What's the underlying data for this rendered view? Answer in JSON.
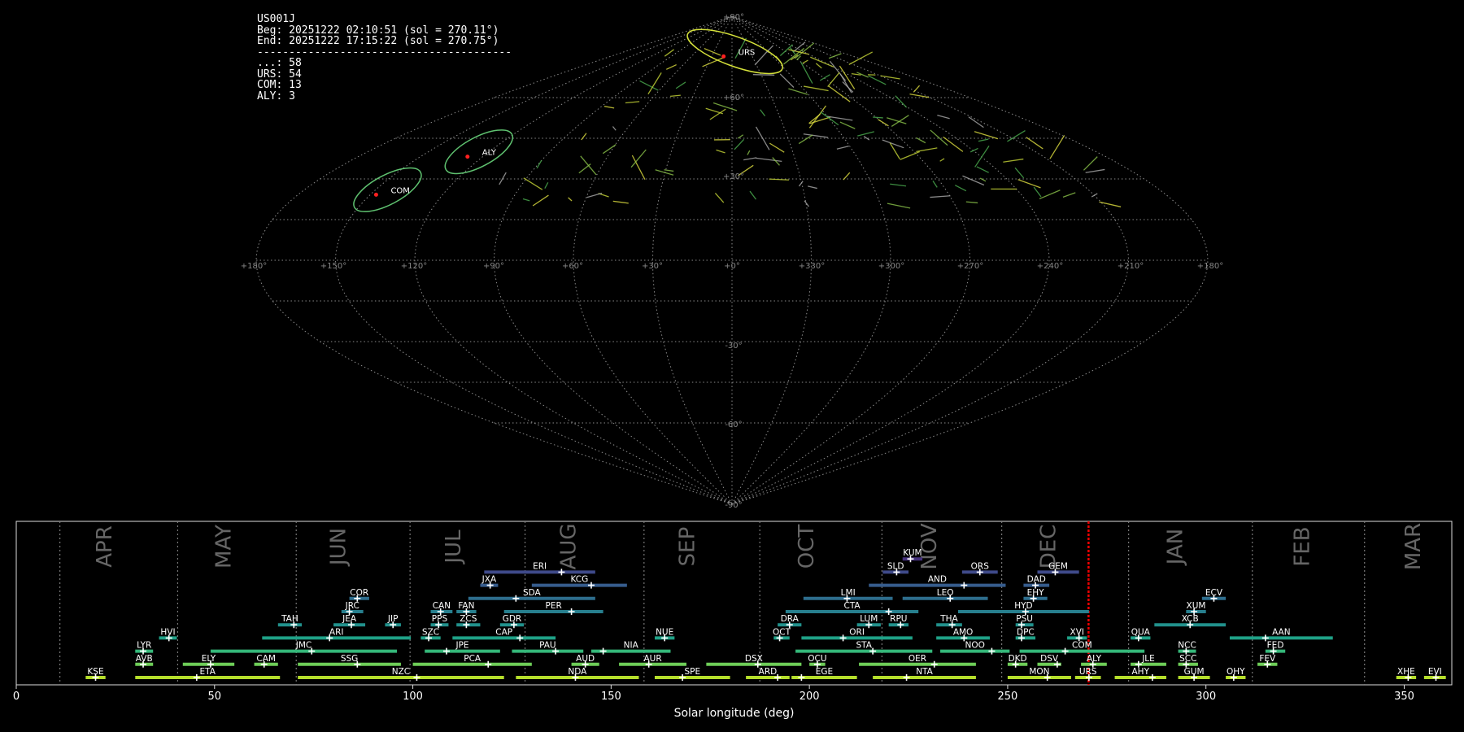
{
  "info_panel": {
    "station": "US001J",
    "begin": "Beg: 20251222 02:10:51 (sol = 270.11°)",
    "end": "End: 20251222 17:15:22 (sol = 270.75°)",
    "separator": "----------------------------------------",
    "counts": [
      "...: 58",
      "URS: 54",
      "COM: 13",
      "ALY: 3"
    ]
  },
  "sky_map": {
    "projection": "sinusoidal",
    "lon_labels": [
      "+180°",
      "+150°",
      "+120°",
      "+90°",
      "+60°",
      "+30°",
      "+0°",
      "+330°",
      "+300°",
      "+270°",
      "+240°",
      "+210°",
      "+180°"
    ],
    "lat_labels": [
      "+90°",
      "+60°",
      "+30°",
      "-30°",
      "-60°",
      "-90°"
    ],
    "radiants": [
      {
        "name": "URS",
        "lon": 355,
        "lat": 77,
        "color": "#d6e23a"
      },
      {
        "name": "ALY",
        "lon": 125,
        "lat": 40,
        "color": "#5fc270"
      },
      {
        "name": "COM",
        "lon": 145,
        "lat": 26,
        "color": "#5fc270"
      }
    ],
    "colors": {
      "grid": "#8a8a8a",
      "radiant_marker": "#ff2020"
    }
  },
  "chart_data": {
    "type": "timeline",
    "xlabel": "Solar longitude (deg)",
    "xlim": [
      0,
      362
    ],
    "xticks": [
      0,
      50,
      100,
      150,
      200,
      250,
      300,
      350
    ],
    "current_sol": 270.4,
    "months": [
      {
        "name": "APR",
        "start": 11,
        "mid": 24
      },
      {
        "name": "MAY",
        "start": 40.7,
        "mid": 54
      },
      {
        "name": "JUN",
        "start": 70.6,
        "mid": 83
      },
      {
        "name": "JUL",
        "start": 99.3,
        "mid": 112
      },
      {
        "name": "AUG",
        "start": 128.3,
        "mid": 141
      },
      {
        "name": "SEP",
        "start": 158.3,
        "mid": 171
      },
      {
        "name": "OCT",
        "start": 187.5,
        "mid": 201
      },
      {
        "name": "NOV",
        "start": 218.3,
        "mid": 232
      },
      {
        "name": "DEC",
        "start": 248.5,
        "mid": 262
      },
      {
        "name": "JAN",
        "start": 280.5,
        "mid": 294
      },
      {
        "name": "FEB",
        "start": 311.7,
        "mid": 326
      },
      {
        "name": "MAR",
        "start": 340,
        "mid": 354
      }
    ],
    "showers": [
      {
        "code": "KUM",
        "row": 10,
        "start": 223.5,
        "end": 228.5,
        "peak": 225.5,
        "color": "#46327e"
      },
      {
        "code": "ERI",
        "row": 9,
        "start": 118,
        "end": 146,
        "peak": 137.5,
        "color": "#3f4a8a"
      },
      {
        "code": "SLD",
        "row": 9,
        "start": 218.5,
        "end": 225,
        "peak": 222,
        "color": "#3f4a8a"
      },
      {
        "code": "ORS",
        "row": 9,
        "start": 238.5,
        "end": 247.5,
        "peak": 243,
        "color": "#3f4a8a"
      },
      {
        "code": "GEM",
        "row": 9,
        "start": 257.5,
        "end": 268,
        "peak": 262,
        "color": "#3f4a8a"
      },
      {
        "code": "JXA",
        "row": 8,
        "start": 117,
        "end": 121.5,
        "peak": 119.5,
        "color": "#365c8d"
      },
      {
        "code": "KCG",
        "row": 8,
        "start": 130,
        "end": 154,
        "peak": 145,
        "color": "#365c8d"
      },
      {
        "code": "AND",
        "row": 8,
        "start": 215,
        "end": 249.5,
        "peak": 239,
        "color": "#365c8d"
      },
      {
        "code": "DAD",
        "row": 8,
        "start": 254,
        "end": 260.5,
        "peak": 257,
        "color": "#365c8d"
      },
      {
        "code": "COR",
        "row": 7,
        "start": 84,
        "end": 89,
        "peak": 86,
        "color": "#2e6e8e"
      },
      {
        "code": "SDA",
        "row": 7,
        "start": 114,
        "end": 146,
        "peak": 126,
        "color": "#2e6e8e"
      },
      {
        "code": "LMI",
        "row": 7,
        "start": 198.5,
        "end": 221,
        "peak": 209.5,
        "color": "#2e6e8e"
      },
      {
        "code": "LEO",
        "row": 7,
        "start": 223.5,
        "end": 245,
        "peak": 235.5,
        "color": "#2e6e8e"
      },
      {
        "code": "EHY",
        "row": 7,
        "start": 254,
        "end": 260,
        "peak": 256.5,
        "color": "#2e6e8e"
      },
      {
        "code": "ECV",
        "row": 7,
        "start": 299,
        "end": 305,
        "peak": 302,
        "color": "#2e6e8e"
      },
      {
        "code": "JRC",
        "row": 6,
        "start": 82,
        "end": 87.5,
        "peak": 84,
        "color": "#277f8e"
      },
      {
        "code": "CAN",
        "row": 6,
        "start": 104.5,
        "end": 110,
        "peak": 107,
        "color": "#277f8e"
      },
      {
        "code": "FAN",
        "row": 6,
        "start": 111,
        "end": 116,
        "peak": 113.5,
        "color": "#277f8e"
      },
      {
        "code": "PER",
        "row": 6,
        "start": 123,
        "end": 148,
        "peak": 140,
        "color": "#277f8e"
      },
      {
        "code": "CTA",
        "row": 6,
        "start": 194,
        "end": 227.5,
        "peak": 220,
        "color": "#277f8e"
      },
      {
        "code": "HYD",
        "row": 6,
        "start": 237.5,
        "end": 270.5,
        "peak": 254.5,
        "color": "#277f8e"
      },
      {
        "code": "XUM",
        "row": 6,
        "start": 295,
        "end": 300,
        "peak": 297,
        "color": "#277f8e"
      },
      {
        "code": "TAH",
        "row": 5,
        "start": 66,
        "end": 72,
        "peak": 70,
        "color": "#21918c"
      },
      {
        "code": "JEA",
        "row": 5,
        "start": 80,
        "end": 88,
        "peak": 84.5,
        "color": "#21918c"
      },
      {
        "code": "JIP",
        "row": 5,
        "start": 93,
        "end": 97,
        "peak": 95,
        "color": "#21918c"
      },
      {
        "code": "PPS",
        "row": 5,
        "start": 104.5,
        "end": 109,
        "peak": 106.5,
        "color": "#21918c"
      },
      {
        "code": "ZCS",
        "row": 5,
        "start": 111,
        "end": 117,
        "peak": 113.5,
        "color": "#21918c"
      },
      {
        "code": "GDR",
        "row": 5,
        "start": 122,
        "end": 128,
        "peak": 125.5,
        "color": "#21918c"
      },
      {
        "code": "DRA",
        "row": 5,
        "start": 192,
        "end": 198,
        "peak": 195,
        "color": "#21918c"
      },
      {
        "code": "LUM",
        "row": 5,
        "start": 212,
        "end": 218,
        "peak": 215,
        "color": "#21918c"
      },
      {
        "code": "RPU",
        "row": 5,
        "start": 220,
        "end": 225,
        "peak": 223,
        "color": "#21918c"
      },
      {
        "code": "THA",
        "row": 5,
        "start": 232,
        "end": 238.5,
        "peak": 236,
        "color": "#21918c"
      },
      {
        "code": "PSU",
        "row": 5,
        "start": 252,
        "end": 256.5,
        "peak": 253.5,
        "color": "#21918c"
      },
      {
        "code": "XCB",
        "row": 5,
        "start": 287,
        "end": 305,
        "peak": 296,
        "color": "#21918c"
      },
      {
        "code": "HVI",
        "row": 4,
        "start": 36,
        "end": 40.5,
        "peak": 38.5,
        "color": "#1fa187"
      },
      {
        "code": "ARI",
        "row": 4,
        "start": 62,
        "end": 99.5,
        "peak": 79,
        "color": "#1fa187"
      },
      {
        "code": "SZC",
        "row": 4,
        "start": 102,
        "end": 107,
        "peak": 104,
        "color": "#1fa187"
      },
      {
        "code": "CAP",
        "row": 4,
        "start": 110,
        "end": 136,
        "peak": 127,
        "color": "#1fa187"
      },
      {
        "code": "NUE",
        "row": 4,
        "start": 161,
        "end": 166,
        "peak": 163.5,
        "color": "#1fa187"
      },
      {
        "code": "OCT",
        "row": 4,
        "start": 191,
        "end": 195,
        "peak": 192.5,
        "color": "#1fa187"
      },
      {
        "code": "ORI",
        "row": 4,
        "start": 198,
        "end": 226,
        "peak": 208.5,
        "color": "#1fa187"
      },
      {
        "code": "AMO",
        "row": 4,
        "start": 232,
        "end": 245.5,
        "peak": 239,
        "color": "#1fa187"
      },
      {
        "code": "DPC",
        "row": 4,
        "start": 252,
        "end": 257,
        "peak": 253.5,
        "color": "#1fa187"
      },
      {
        "code": "XVI",
        "row": 4,
        "start": 265,
        "end": 270,
        "peak": 268,
        "color": "#1fa187"
      },
      {
        "code": "QUA",
        "row": 4,
        "start": 281,
        "end": 286,
        "peak": 283,
        "color": "#1fa187"
      },
      {
        "code": "AAN",
        "row": 4,
        "start": 306,
        "end": 332,
        "peak": 315,
        "color": "#1fa187"
      },
      {
        "code": "LYR",
        "row": 3,
        "start": 30,
        "end": 34.5,
        "peak": 32,
        "color": "#35b779"
      },
      {
        "code": "JMC",
        "row": 3,
        "start": 49,
        "end": 96,
        "peak": 74.5,
        "color": "#35b779"
      },
      {
        "code": "JPE",
        "row": 3,
        "start": 103,
        "end": 122,
        "peak": 108.5,
        "color": "#35b779"
      },
      {
        "code": "PAU",
        "row": 3,
        "start": 125,
        "end": 143,
        "peak": 136,
        "color": "#35b779"
      },
      {
        "code": "NIA",
        "row": 3,
        "start": 145,
        "end": 165,
        "peak": 148,
        "color": "#35b779"
      },
      {
        "code": "STA",
        "row": 3,
        "start": 196.5,
        "end": 231,
        "peak": 216,
        "color": "#35b779"
      },
      {
        "code": "NOO",
        "row": 3,
        "start": 233,
        "end": 250.5,
        "peak": 246,
        "color": "#35b779"
      },
      {
        "code": "COM",
        "row": 3,
        "start": 253,
        "end": 284.5,
        "peak": 264.5,
        "color": "#35b779"
      },
      {
        "code": "NCC",
        "row": 3,
        "start": 293,
        "end": 297.5,
        "peak": 295,
        "color": "#35b779"
      },
      {
        "code": "FED",
        "row": 3,
        "start": 315,
        "end": 320,
        "peak": 317,
        "color": "#35b779"
      },
      {
        "code": "AVB",
        "row": 2,
        "start": 30,
        "end": 34.5,
        "peak": 32,
        "color": "#6ece58"
      },
      {
        "code": "ELY",
        "row": 2,
        "start": 42,
        "end": 55,
        "peak": 49,
        "color": "#6ece58"
      },
      {
        "code": "CAM",
        "row": 2,
        "start": 60,
        "end": 66,
        "peak": 62.5,
        "color": "#6ece58"
      },
      {
        "code": "SSG",
        "row": 2,
        "start": 71,
        "end": 97,
        "peak": 86,
        "color": "#6ece58"
      },
      {
        "code": "PCA",
        "row": 2,
        "start": 100,
        "end": 130,
        "peak": 119,
        "color": "#6ece58"
      },
      {
        "code": "AUD",
        "row": 2,
        "start": 140,
        "end": 147,
        "peak": 143.5,
        "color": "#6ece58"
      },
      {
        "code": "AUR",
        "row": 2,
        "start": 152,
        "end": 169,
        "peak": 159.5,
        "color": "#6ece58"
      },
      {
        "code": "DSX",
        "row": 2,
        "start": 174,
        "end": 198,
        "peak": 187,
        "color": "#6ece58"
      },
      {
        "code": "OCU",
        "row": 2,
        "start": 200,
        "end": 204,
        "peak": 202,
        "color": "#6ece58"
      },
      {
        "code": "OER",
        "row": 2,
        "start": 212.5,
        "end": 242,
        "peak": 231.5,
        "color": "#6ece58"
      },
      {
        "code": "DKD",
        "row": 2,
        "start": 250,
        "end": 255,
        "peak": 252,
        "color": "#6ece58"
      },
      {
        "code": "DSV",
        "row": 2,
        "start": 257.5,
        "end": 263.5,
        "peak": 262.5,
        "color": "#6ece58"
      },
      {
        "code": "ALY",
        "row": 2,
        "start": 268.5,
        "end": 275,
        "peak": 271.5,
        "color": "#6ece58"
      },
      {
        "code": "JLE",
        "row": 2,
        "start": 281,
        "end": 290,
        "peak": 283,
        "color": "#6ece58"
      },
      {
        "code": "SCC",
        "row": 2,
        "start": 293,
        "end": 298,
        "peak": 295,
        "color": "#6ece58"
      },
      {
        "code": "FEV",
        "row": 2,
        "start": 313,
        "end": 318,
        "peak": 315.5,
        "color": "#6ece58"
      },
      {
        "code": "KSE",
        "row": 1,
        "start": 17.5,
        "end": 22.5,
        "peak": 20,
        "color": "#b5de2b"
      },
      {
        "code": "ETA",
        "row": 1,
        "start": 30,
        "end": 66.5,
        "peak": 45.5,
        "color": "#b5de2b"
      },
      {
        "code": "NZC",
        "row": 1,
        "start": 71,
        "end": 123,
        "peak": 101,
        "color": "#b5de2b"
      },
      {
        "code": "NDA",
        "row": 1,
        "start": 126,
        "end": 157,
        "peak": 141,
        "color": "#b5de2b"
      },
      {
        "code": "SPE",
        "row": 1,
        "start": 161,
        "end": 180,
        "peak": 168,
        "color": "#b5de2b"
      },
      {
        "code": "ARD",
        "row": 1,
        "start": 184,
        "end": 195,
        "peak": 192,
        "color": "#b5de2b"
      },
      {
        "code": "EGE",
        "row": 1,
        "start": 195.5,
        "end": 212,
        "peak": 198,
        "color": "#b5de2b"
      },
      {
        "code": "NTA",
        "row": 1,
        "start": 216,
        "end": 242,
        "peak": 224.5,
        "color": "#b5de2b"
      },
      {
        "code": "MON",
        "row": 1,
        "start": 250,
        "end": 266,
        "peak": 260,
        "color": "#b5de2b"
      },
      {
        "code": "URS",
        "row": 1,
        "start": 267,
        "end": 273.5,
        "peak": 270.5,
        "color": "#b5de2b"
      },
      {
        "code": "AHY",
        "row": 1,
        "start": 277,
        "end": 290,
        "peak": 286.5,
        "color": "#b5de2b"
      },
      {
        "code": "GUM",
        "row": 1,
        "start": 293,
        "end": 301,
        "peak": 297,
        "color": "#b5de2b"
      },
      {
        "code": "OHY",
        "row": 1,
        "start": 305,
        "end": 310,
        "peak": 307,
        "color": "#b5de2b"
      },
      {
        "code": "XHE",
        "row": 1,
        "start": 348,
        "end": 353,
        "peak": 351,
        "color": "#b5de2b"
      },
      {
        "code": "EVI",
        "row": 1,
        "start": 355,
        "end": 360.5,
        "peak": 358,
        "color": "#b5de2b"
      }
    ]
  }
}
